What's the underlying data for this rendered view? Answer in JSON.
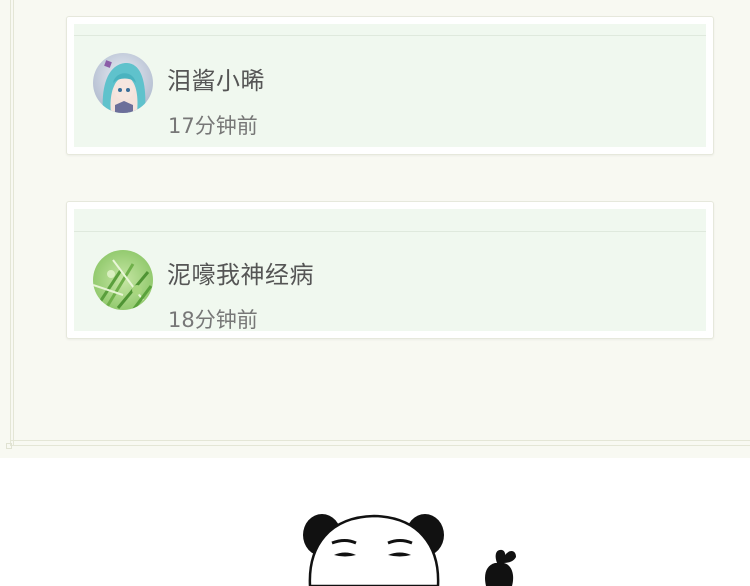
{
  "comments": [
    {
      "username": "泪酱小晞",
      "time": "17分钟前",
      "avatar_icon": "anime-girl-avatar-icon"
    },
    {
      "username": "泥嚎我神经病",
      "time": "18分钟前",
      "avatar_icon": "green-grass-avatar-icon"
    }
  ],
  "colors": {
    "frame_background": "#f8f9f2",
    "card_inner": "#f0f8ef",
    "username_text": "#555555",
    "time_text": "#777777"
  },
  "sticker_icon": "panda-man-finger-heart-icon"
}
